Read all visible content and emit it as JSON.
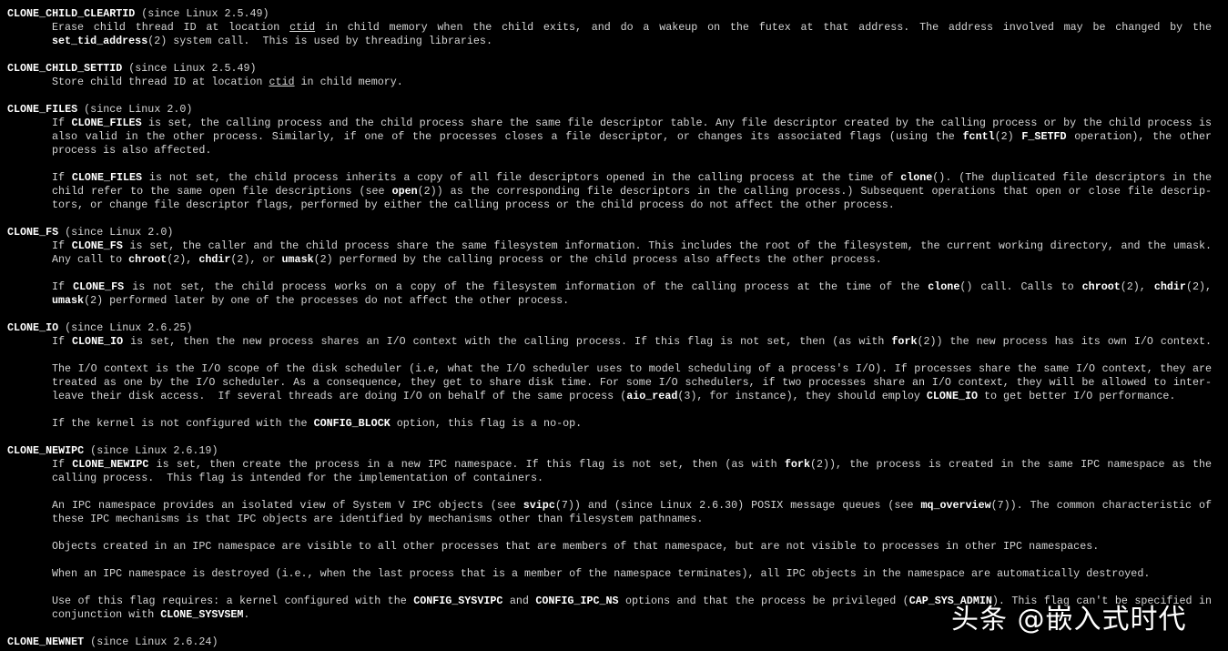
{
  "terminal": {
    "lines": [
      {
        "kind": "heading",
        "segments": [
          {
            "b": "CLONE_CHILD_CLEARTID"
          },
          " (since Linux 2.5.49)"
        ]
      },
      {
        "kind": "body",
        "justify": true,
        "segments": [
          "Erase child thread ID at location ",
          {
            "u": "ctid"
          },
          " in child memory when the child exits, and do a wakeup on the futex at that address. The address involved may be changed by the"
        ]
      },
      {
        "kind": "body",
        "segments": [
          {
            "b": "set_tid_address"
          },
          "(2) system call.  This is used by threading libraries."
        ]
      },
      {
        "kind": "blank",
        "segments": []
      },
      {
        "kind": "heading",
        "segments": [
          {
            "b": "CLONE_CHILD_SETTID"
          },
          " (since Linux 2.5.49)"
        ]
      },
      {
        "kind": "body",
        "segments": [
          "Store child thread ID at location ",
          {
            "u": "ctid"
          },
          " in child memory."
        ]
      },
      {
        "kind": "blank",
        "segments": []
      },
      {
        "kind": "heading",
        "segments": [
          {
            "b": "CLONE_FILES"
          },
          " (since Linux 2.0)"
        ]
      },
      {
        "kind": "body",
        "justify": true,
        "segments": [
          "If ",
          {
            "b": "CLONE_FILES"
          },
          " is set, the calling process and the child process share the same file descriptor table.  Any file descriptor created by the calling process or by the child process is"
        ]
      },
      {
        "kind": "body",
        "justify": true,
        "segments": [
          "also valid in the other process.  Similarly, if one of the processes closes a file descriptor, or changes its associated flags (using the ",
          {
            "b": "fcntl"
          },
          "(2) ",
          {
            "b": "F_SETFD"
          },
          " operation), the other"
        ]
      },
      {
        "kind": "body",
        "segments": [
          "process is also affected."
        ]
      },
      {
        "kind": "blank",
        "segments": []
      },
      {
        "kind": "body",
        "justify": true,
        "segments": [
          "If ",
          {
            "b": "CLONE_FILES"
          },
          " is not set, the child process inherits a copy of all file descriptors opened in the calling process at the time of ",
          {
            "b": "clone"
          },
          "().  (The duplicated file descriptors in the"
        ]
      },
      {
        "kind": "body",
        "justify": true,
        "segments": [
          "child refer to the same open file descriptions (see ",
          {
            "b": "open"
          },
          "(2)) as the corresponding file descriptors in the calling process.)  Subsequent operations that open or close file descrip-"
        ]
      },
      {
        "kind": "body",
        "segments": [
          "tors, or change file descriptor flags, performed by either the calling process or the child process do not affect the other process."
        ]
      },
      {
        "kind": "blank",
        "segments": []
      },
      {
        "kind": "heading",
        "segments": [
          {
            "b": "CLONE_FS"
          },
          " (since Linux 2.0)"
        ]
      },
      {
        "kind": "body",
        "justify": true,
        "segments": [
          "If ",
          {
            "b": "CLONE_FS"
          },
          " is set, the caller and the child process share the same filesystem information.  This includes the root of the filesystem, the current working directory, and the umask."
        ]
      },
      {
        "kind": "body",
        "segments": [
          "Any call to ",
          {
            "b": "chroot"
          },
          "(2), ",
          {
            "b": "chdir"
          },
          "(2), or ",
          {
            "b": "umask"
          },
          "(2) performed by the calling process or the child process also affects the other process."
        ]
      },
      {
        "kind": "blank",
        "segments": []
      },
      {
        "kind": "body",
        "justify": true,
        "segments": [
          "If ",
          {
            "b": "CLONE_FS"
          },
          " is not set, the child process works on a copy of the filesystem information of the calling process at the time of the ",
          {
            "b": "clone"
          },
          "() call.  Calls to ",
          {
            "b": "chroot"
          },
          "(2), ",
          {
            "b": "chdir"
          },
          "(2),"
        ]
      },
      {
        "kind": "body",
        "segments": [
          {
            "b": "umask"
          },
          "(2) performed later by one of the processes do not affect the other process."
        ]
      },
      {
        "kind": "blank",
        "segments": []
      },
      {
        "kind": "heading",
        "segments": [
          {
            "b": "CLONE_IO"
          },
          " (since Linux 2.6.25)"
        ]
      },
      {
        "kind": "body",
        "justify": true,
        "segments": [
          "If ",
          {
            "b": "CLONE_IO"
          },
          " is set, then the new process shares an I/O context with the calling process.  If this flag is not set, then (as with ",
          {
            "b": "fork"
          },
          "(2)) the new process has its own I/O context."
        ]
      },
      {
        "kind": "blank",
        "segments": []
      },
      {
        "kind": "body",
        "justify": true,
        "segments": [
          "The I/O context is the I/O scope of the disk scheduler (i.e, what the I/O scheduler uses to model scheduling of a process's I/O).  If processes share the same I/O context, they are"
        ]
      },
      {
        "kind": "body",
        "justify": true,
        "segments": [
          "treated as one by the I/O scheduler.  As a consequence, they get to share disk time.  For some I/O schedulers, if two processes share an I/O context, they will be allowed to inter-"
        ]
      },
      {
        "kind": "body",
        "segments": [
          "leave their disk access.  If several threads are doing I/O on behalf of the same process (",
          {
            "b": "aio_read"
          },
          "(3), for instance), they should employ ",
          {
            "b": "CLONE_IO"
          },
          " to get better I/O performance."
        ]
      },
      {
        "kind": "blank",
        "segments": []
      },
      {
        "kind": "body",
        "segments": [
          "If the kernel is not configured with the ",
          {
            "b": "CONFIG_BLOCK"
          },
          " option, this flag is a no-op."
        ]
      },
      {
        "kind": "blank",
        "segments": []
      },
      {
        "kind": "heading",
        "segments": [
          {
            "b": "CLONE_NEWIPC"
          },
          " (since Linux 2.6.19)"
        ]
      },
      {
        "kind": "body",
        "justify": true,
        "segments": [
          "If ",
          {
            "b": "CLONE_NEWIPC"
          },
          " is set, then create the process in a new IPC namespace.  If this flag is not set, then (as with ",
          {
            "b": "fork"
          },
          "(2)), the process is created in the same IPC namespace as the"
        ]
      },
      {
        "kind": "body",
        "segments": [
          "calling process.  This flag is intended for the implementation of containers."
        ]
      },
      {
        "kind": "blank",
        "segments": []
      },
      {
        "kind": "body",
        "justify": true,
        "segments": [
          "An IPC namespace provides an isolated view of System V IPC objects (see ",
          {
            "b": "svipc"
          },
          "(7)) and (since Linux 2.6.30) POSIX message queues (see ",
          {
            "b": "mq_overview"
          },
          "(7)).  The common characteristic of"
        ]
      },
      {
        "kind": "body",
        "segments": [
          "these IPC mechanisms is that IPC objects are identified by mechanisms other than filesystem pathnames."
        ]
      },
      {
        "kind": "blank",
        "segments": []
      },
      {
        "kind": "body",
        "segments": [
          "Objects created in an IPC namespace are visible to all other processes that are members of that namespace, but are not visible to processes in other IPC namespaces."
        ]
      },
      {
        "kind": "blank",
        "segments": []
      },
      {
        "kind": "body",
        "segments": [
          "When an IPC namespace is destroyed (i.e., when the last process that is a member of the namespace terminates), all IPC objects in the namespace are automatically destroyed."
        ]
      },
      {
        "kind": "blank",
        "segments": []
      },
      {
        "kind": "body",
        "justify": true,
        "segments": [
          "Use of this flag requires: a kernel configured with the ",
          {
            "b": "CONFIG_SYSVIPC"
          },
          " and ",
          {
            "b": "CONFIG_IPC_NS"
          },
          " options and that the process be privileged (",
          {
            "b": "CAP_SYS_ADMIN"
          },
          ").  This flag can't be specified in"
        ]
      },
      {
        "kind": "body",
        "segments": [
          "conjunction with ",
          {
            "b": "CLONE_SYSVSEM"
          },
          "."
        ]
      },
      {
        "kind": "blank",
        "segments": []
      },
      {
        "kind": "heading",
        "segments": [
          {
            "b": "CLONE_NEWNET"
          },
          " (since Linux 2.6.24)"
        ]
      }
    ]
  },
  "watermark": {
    "text": "头条 @嵌入式时代"
  },
  "colors": {
    "background": "#000000",
    "text": "#d4d4d4",
    "bold": "#ffffff"
  }
}
